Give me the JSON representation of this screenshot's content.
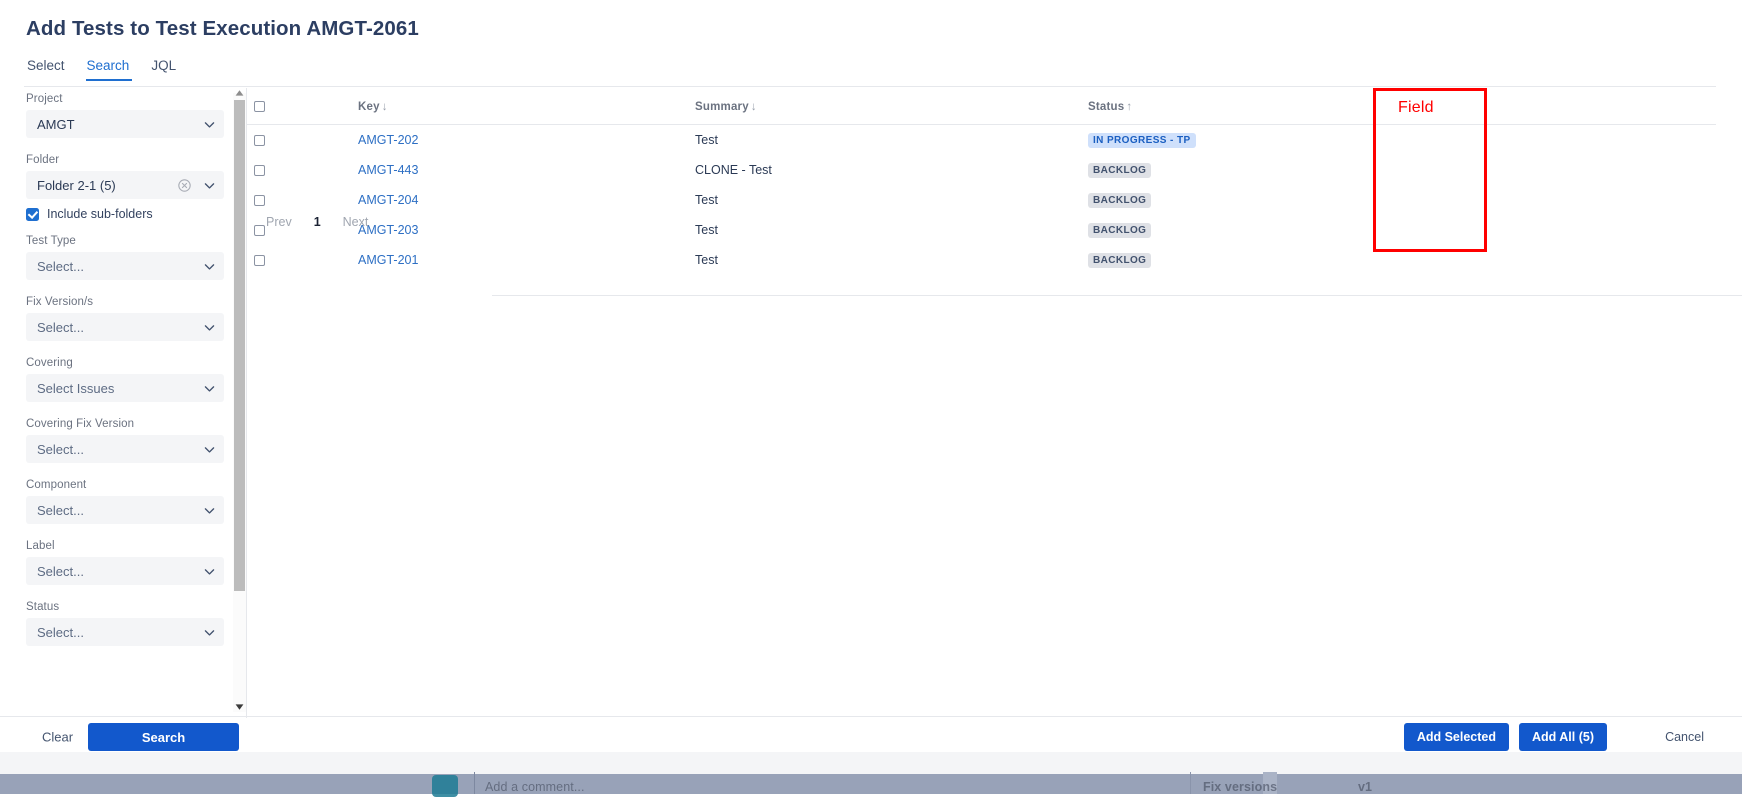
{
  "modal": {
    "title": "Add Tests to Test Execution AMGT-2061",
    "tabs": [
      {
        "label": "Select",
        "active": false
      },
      {
        "label": "Search",
        "active": true
      },
      {
        "label": "JQL",
        "active": false
      }
    ]
  },
  "filters": {
    "fields": [
      {
        "label": "Project",
        "value": "AMGT",
        "filled": true,
        "clearable": false
      },
      {
        "label": "Folder",
        "value": "Folder 2-1 (5)",
        "filled": true,
        "clearable": true
      },
      {
        "label": "Test Type",
        "value": "Select...",
        "filled": false,
        "clearable": false
      },
      {
        "label": "Fix Version/s",
        "value": "Select...",
        "filled": false,
        "clearable": false
      },
      {
        "label": "Covering",
        "value": "Select Issues",
        "filled": false,
        "clearable": false
      },
      {
        "label": "Covering Fix Version",
        "value": "Select...",
        "filled": false,
        "clearable": false
      },
      {
        "label": "Component",
        "value": "Select...",
        "filled": false,
        "clearable": false
      },
      {
        "label": "Label",
        "value": "Select...",
        "filled": false,
        "clearable": false
      },
      {
        "label": "Status",
        "value": "Select...",
        "filled": false,
        "clearable": false
      }
    ],
    "include_subfolders": {
      "label": "Include sub-folders",
      "checked": true
    }
  },
  "results": {
    "columns": [
      {
        "label": "",
        "sort": ""
      },
      {
        "label": "Key",
        "sort": "↓"
      },
      {
        "label": "Summary",
        "sort": "↓"
      },
      {
        "label": "Status",
        "sort": "↑"
      }
    ],
    "rows": [
      {
        "checked": false,
        "key": "AMGT-202",
        "summary": "Test",
        "status": "IN PROGRESS - TP",
        "status_kind": "inprogress"
      },
      {
        "checked": false,
        "key": "AMGT-443",
        "summary": "CLONE - Test",
        "status": "BACKLOG",
        "status_kind": "backlog"
      },
      {
        "checked": false,
        "key": "AMGT-204",
        "summary": "Test",
        "status": "BACKLOG",
        "status_kind": "backlog"
      },
      {
        "checked": false,
        "key": "AMGT-203",
        "summary": "Test",
        "status": "BACKLOG",
        "status_kind": "backlog"
      },
      {
        "checked": false,
        "key": "AMGT-201",
        "summary": "Test",
        "status": "BACKLOG",
        "status_kind": "backlog"
      }
    ],
    "pagination": {
      "prev": "Prev",
      "current": "1",
      "next": "Next"
    }
  },
  "annotation": {
    "label": "Field",
    "color": "#ff0000"
  },
  "actions": {
    "clear": "Clear",
    "search": "Search",
    "add_selected": "Add Selected",
    "add_all": "Add All (5)",
    "cancel": "Cancel"
  },
  "background": {
    "comment_placeholder": "Add a comment...",
    "fix_versions_label": "Fix versions",
    "fix_versions_value": "v1"
  },
  "colors": {
    "accent": "#1258cc",
    "link": "#2d6fc4",
    "title": "#2c3e62",
    "annotation": "#ff0000",
    "badge_inprogress_bg": "#cfe0fb",
    "badge_backlog_bg": "#dfe1e6"
  }
}
